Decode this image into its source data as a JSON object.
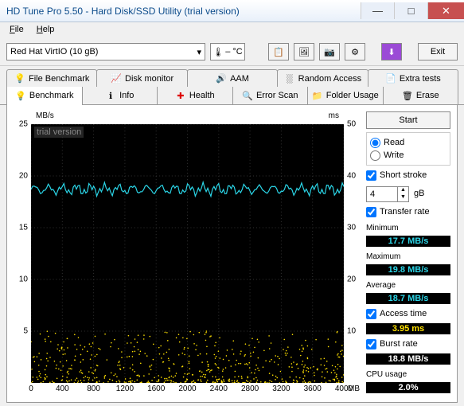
{
  "window": {
    "title": "HD Tune Pro 5.50 - Hard Disk/SSD Utility (trial version)"
  },
  "menu": {
    "file": "File",
    "help": "Help"
  },
  "toolbar": {
    "device": "Red Hat VirtIO (10 gB)",
    "temp": "– °C",
    "exit": "Exit"
  },
  "tabs_top": [
    {
      "label": "File Benchmark"
    },
    {
      "label": "Disk monitor"
    },
    {
      "label": "AAM"
    },
    {
      "label": "Random Access"
    },
    {
      "label": "Extra tests"
    }
  ],
  "tabs_bottom": [
    {
      "label": "Benchmark"
    },
    {
      "label": "Info"
    },
    {
      "label": "Health"
    },
    {
      "label": "Error Scan"
    },
    {
      "label": "Folder Usage"
    },
    {
      "label": "Erase"
    }
  ],
  "side": {
    "start": "Start",
    "read": "Read",
    "write": "Write",
    "short_stroke": "Short stroke",
    "short_val": "4",
    "gb": "gB",
    "transfer_rate": "Transfer rate",
    "minimum": "Minimum",
    "min_val": "17.7 MB/s",
    "maximum": "Maximum",
    "max_val": "19.8 MB/s",
    "average": "Average",
    "avg_val": "18.7 MB/s",
    "access_time": "Access time",
    "access_val": "3.95 ms",
    "burst_rate": "Burst rate",
    "burst_val": "18.8 MB/s",
    "cpu_usage": "CPU usage",
    "cpu_val": "2.0%"
  },
  "chart_data": {
    "type": "line+scatter",
    "title": "",
    "watermark": "trial version",
    "x_unit": "MB",
    "y_left_unit": "MB/s",
    "y_right_unit": "ms",
    "x_ticks": [
      0,
      400,
      800,
      1200,
      1600,
      2000,
      2400,
      2800,
      3200,
      3600,
      4000
    ],
    "y_left_ticks": [
      5,
      10,
      15,
      20,
      25
    ],
    "y_right_ticks": [
      10,
      20,
      30,
      40,
      50
    ],
    "xlim": [
      0,
      4000
    ],
    "ylim_left": [
      0,
      25
    ],
    "ylim_right": [
      0,
      50
    ],
    "series": [
      {
        "name": "Transfer rate",
        "axis": "left",
        "type": "line",
        "color": "#2bd6e8",
        "avg": 18.7,
        "min": 17.7,
        "max": 19.8,
        "note": "noisy line hovering around 18.7 MB/s across full x-range"
      },
      {
        "name": "Access time",
        "axis": "right",
        "type": "scatter",
        "color": "#ffe000",
        "avg": 3.95,
        "note": "dense scatter between ~0 and ~10 ms, concentrated below 5 ms"
      }
    ]
  }
}
